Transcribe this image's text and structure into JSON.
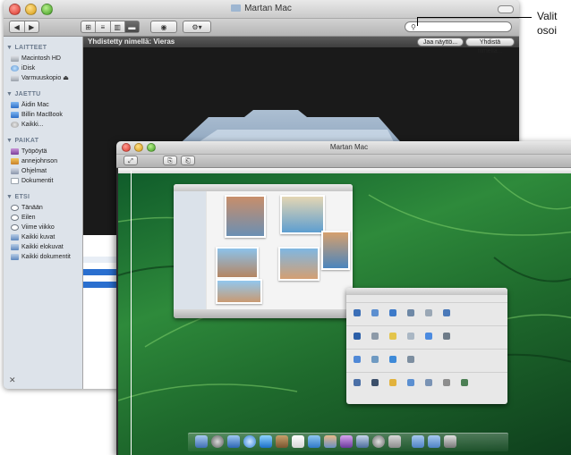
{
  "finder": {
    "title": "Martan Mac",
    "search_placeholder": "",
    "connected_text": "Yhdistetty nimellä: Vieras",
    "share_screen_button": "Jaa näyttö...",
    "connect_as_button": "Yhdistä nimellä...",
    "sidebar": {
      "devices_header": "LAITTEET",
      "devices": [
        "Macintosh HD",
        "iDisk",
        "Varmuuskopio"
      ],
      "shared_header": "JAETTU",
      "shared": [
        "Äidin Mac",
        "Billin MacBook",
        "Kaikki..."
      ],
      "places_header": "PAIKAT",
      "places": [
        "Työpöytä",
        "annejohnson",
        "Ohjelmat",
        "Dokumentit"
      ],
      "search_header": "ETSI",
      "search": [
        "Tänään",
        "Eilen",
        "Viime viikko",
        "Kaikki kuvat",
        "Kaikki elokuvat",
        "Kaikki dokumentit"
      ]
    }
  },
  "callout": {
    "line1": "Valit",
    "line2": "osoi"
  },
  "share_window": {
    "title": "Martan Mac"
  },
  "icons": {
    "back": "back-arrow-icon",
    "forward": "forward-arrow-icon",
    "eye": "quicklook-eye-icon",
    "gear": "gear-icon"
  }
}
